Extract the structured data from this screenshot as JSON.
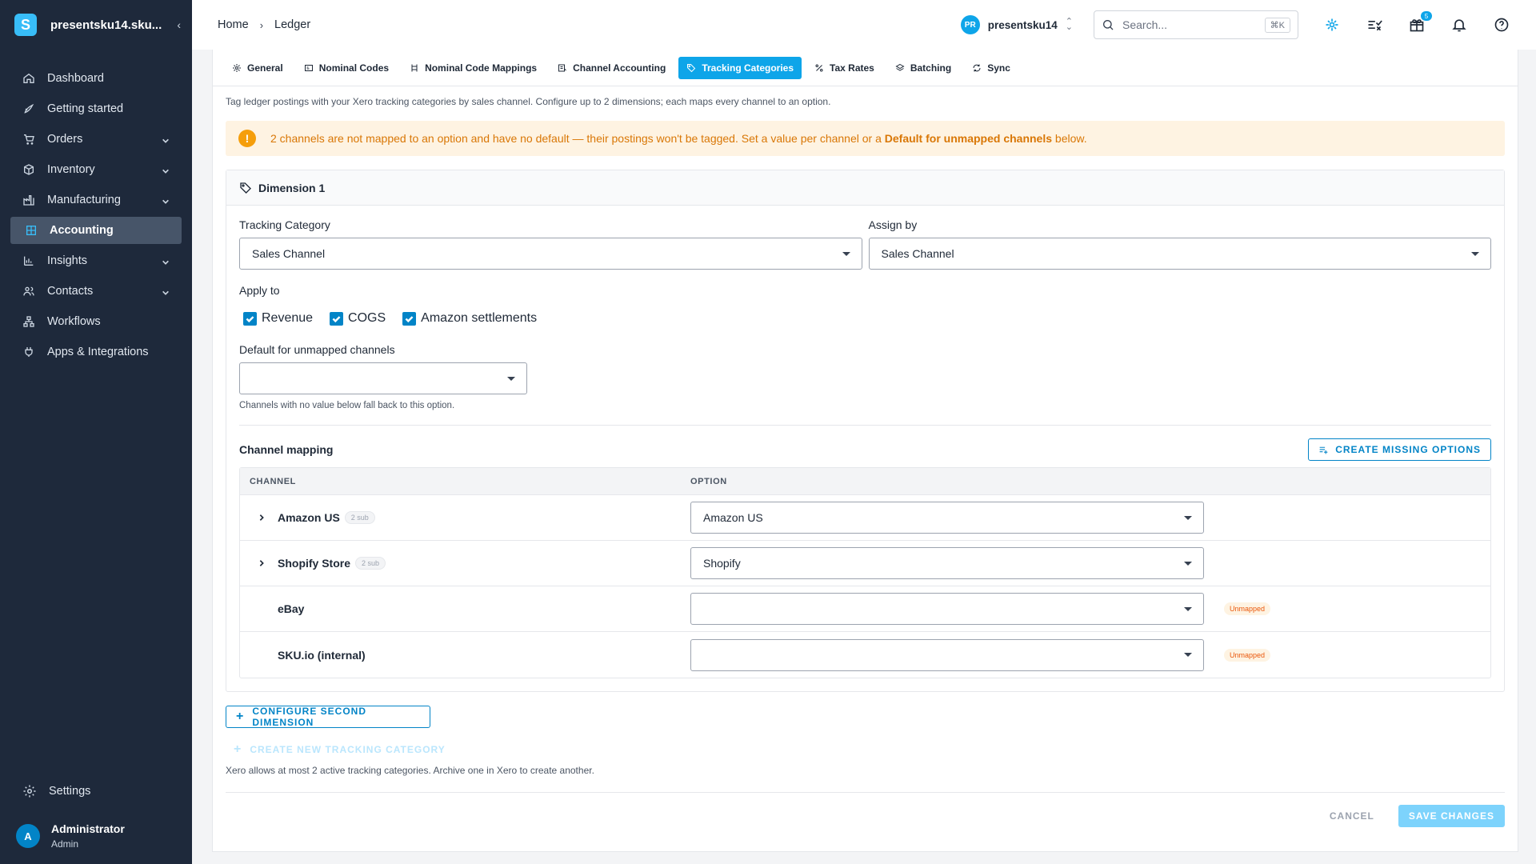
{
  "app": {
    "org_short": "presentsku14.sku...",
    "logo_letter": "S"
  },
  "sidebar": {
    "items": [
      {
        "label": "Dashboard",
        "icon": "home-icon",
        "expandable": false
      },
      {
        "label": "Getting started",
        "icon": "rocket-icon",
        "expandable": false
      },
      {
        "label": "Orders",
        "icon": "cart-icon",
        "expandable": true
      },
      {
        "label": "Inventory",
        "icon": "box-icon",
        "expandable": true
      },
      {
        "label": "Manufacturing",
        "icon": "factory-icon",
        "expandable": true
      },
      {
        "label": "Accounting",
        "icon": "ledger-icon",
        "expandable": false,
        "active": true
      },
      {
        "label": "Insights",
        "icon": "bar-chart-icon",
        "expandable": true
      },
      {
        "label": "Contacts",
        "icon": "users-icon",
        "expandable": true
      },
      {
        "label": "Workflows",
        "icon": "workflow-icon",
        "expandable": false
      },
      {
        "label": "Apps & Integrations",
        "icon": "plug-icon",
        "expandable": false
      }
    ],
    "settings_label": "Settings",
    "user": {
      "initial": "A",
      "name": "Administrator",
      "role": "Admin"
    }
  },
  "header": {
    "breadcrumb": [
      "Home",
      "Ledger"
    ],
    "org_initials": "PR",
    "org_name": "presentsku14",
    "search_placeholder": "Search...",
    "search_shortcut": "⌘K",
    "gift_badge": "5"
  },
  "tabs": [
    {
      "label": "General",
      "icon": "gear-icon"
    },
    {
      "label": "Nominal Codes",
      "icon": "codes-icon"
    },
    {
      "label": "Nominal Code Mappings",
      "icon": "mapping-icon"
    },
    {
      "label": "Channel Accounting",
      "icon": "channel-icon"
    },
    {
      "label": "Tracking Categories",
      "icon": "tag-icon",
      "active": true
    },
    {
      "label": "Tax Rates",
      "icon": "percent-icon"
    },
    {
      "label": "Batching",
      "icon": "layers-icon"
    },
    {
      "label": "Sync",
      "icon": "sync-icon"
    }
  ],
  "intro": "Tag ledger postings with your Xero tracking categories by sales channel. Configure up to 2 dimensions; each maps every channel to an option.",
  "alert": {
    "text_before": "2 channels are not mapped to an option and have no default — their postings won't be tagged. Set a value per channel or a ",
    "text_bold": "Default for unmapped channels",
    "text_after": " below."
  },
  "dimension": {
    "title": "Dimension 1",
    "tracking_category_label": "Tracking Category",
    "tracking_category_value": "Sales Channel",
    "assign_by_label": "Assign by",
    "assign_by_value": "Sales Channel",
    "apply_to_label": "Apply to",
    "apply_to": [
      {
        "label": "Revenue",
        "checked": true
      },
      {
        "label": "COGS",
        "checked": true
      },
      {
        "label": "Amazon settlements",
        "checked": true
      }
    ],
    "default_label": "Default for unmapped channels",
    "default_value": "",
    "default_helper": "Channels with no value below fall back to this option.",
    "mapping_title": "Channel mapping",
    "create_missing_label": "CREATE MISSING OPTIONS",
    "columns": [
      "CHANNEL",
      "OPTION"
    ],
    "rows": [
      {
        "channel": "Amazon US",
        "sub": "2 sub",
        "option": "Amazon US",
        "status": ""
      },
      {
        "channel": "Shopify Store",
        "sub": "2 sub",
        "option": "Shopify",
        "status": ""
      },
      {
        "channel": "eBay",
        "sub": "",
        "option": "",
        "status": "Unmapped"
      },
      {
        "channel": "SKU.io (internal)",
        "sub": "",
        "option": "",
        "status": "Unmapped"
      }
    ]
  },
  "configure_second_label": "CONFIGURE SECOND DIMENSION",
  "create_new_label": "CREATE NEW TRACKING CATEGORY",
  "limit_note": "Xero allows at most 2 active tracking categories. Archive one in Xero to create another.",
  "footer": {
    "cancel_label": "CANCEL",
    "save_label": "SAVE CHANGES"
  },
  "colors": {
    "sidebar_bg": "#1e293b",
    "accent": "#0ea5e9",
    "warning_bg": "#fef3e2",
    "warning_text": "#d97706"
  }
}
